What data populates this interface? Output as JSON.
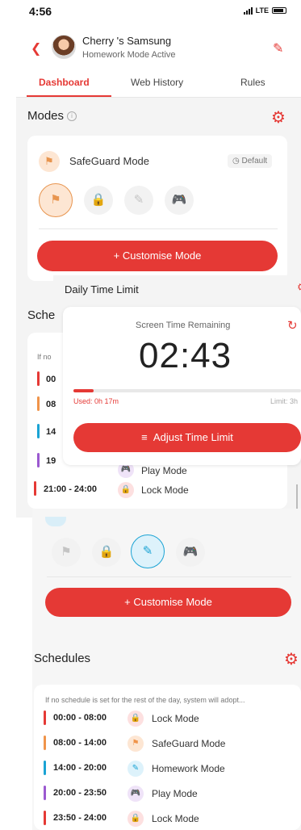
{
  "status": {
    "time": "4:56",
    "network": "LTE"
  },
  "header": {
    "device_name": "Cherry 's Samsung",
    "device_status": "Homework Mode Active"
  },
  "tabs": [
    {
      "label": "Dashboard",
      "active": true
    },
    {
      "label": "Web History",
      "active": false
    },
    {
      "label": "Rules",
      "active": false
    }
  ],
  "modes": {
    "title": "Modes",
    "current_mode": "SafeGuard Mode",
    "default_label": "Default",
    "customise_label": "+   Customise Mode"
  },
  "overlay": {
    "title": "Daily Time Limit",
    "screen_time_label": "Screen Time Remaining",
    "timer": "02:43",
    "used_label": "Used: 0h 17m",
    "limit_label": "Limit: 3h",
    "used_fraction": 0.09,
    "adjust_label": "Adjust Time Limit"
  },
  "upper_schedules": {
    "title_fragment": "Sche",
    "hint_fragment": "If no",
    "partial_times": [
      "00",
      "08",
      "14",
      "19"
    ],
    "partial_label": "Play Mode",
    "last_row": {
      "time": "21:00 - 24:00",
      "label": "Lock Mode"
    }
  },
  "lower_modes": {
    "customise_label": "+   Customise Mode"
  },
  "schedules": {
    "title": "Schedules",
    "hint": "If no schedule is set for the rest of the day, system will adopt...",
    "items": [
      {
        "time": "00:00 - 08:00",
        "label": "Lock Mode",
        "color": "#e53935",
        "icon": "lock-icon"
      },
      {
        "time": "08:00 - 14:00",
        "label": "SafeGuard Mode",
        "color": "#f0944a",
        "icon": "safeguard-icon"
      },
      {
        "time": "14:00 - 20:00",
        "label": "Homework Mode",
        "color": "#1aa3d4",
        "icon": "homework-icon"
      },
      {
        "time": "20:00 - 23:50",
        "label": "Play Mode",
        "color": "#9b59d0",
        "icon": "gamepad-icon"
      },
      {
        "time": "23:50 - 24:00",
        "label": "Lock Mode",
        "color": "#e53935",
        "icon": "lock-icon"
      }
    ]
  },
  "colors": {
    "accent": "#e53935",
    "safeguard": "#e8954f",
    "homework": "#1aa3d4",
    "play": "#9b59d0"
  }
}
